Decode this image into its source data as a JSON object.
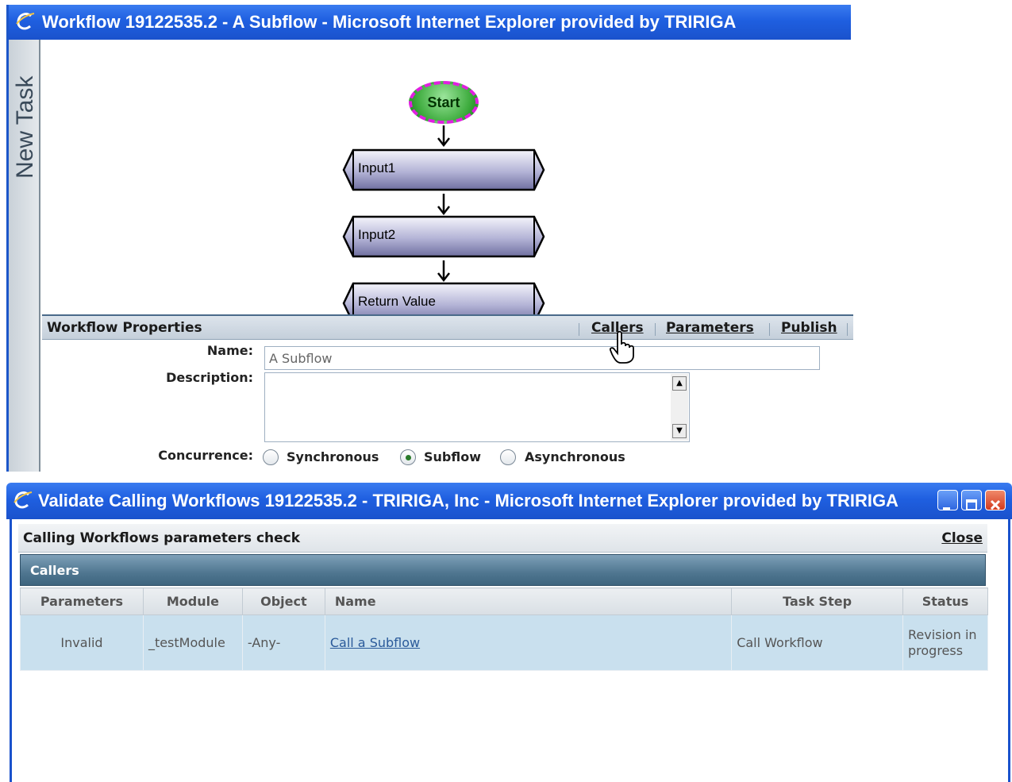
{
  "window1": {
    "title": "Workflow 19122535.2 - A Subflow - Microsoft Internet Explorer provided by TRIRIGA",
    "side_tab": "New Task",
    "diagram": {
      "start": "Start",
      "steps": [
        "Input1",
        "Input2",
        "Return Value"
      ]
    },
    "properties": {
      "title": "Workflow Properties",
      "links": {
        "callers": "Callers",
        "parameters": "Parameters",
        "publish": "Publish"
      },
      "name_label": "Name:",
      "name_value": "A Subflow",
      "description_label": "Description:",
      "description_value": "",
      "concurrence_label": "Concurrence:",
      "concurrence_options": [
        "Synchronous",
        "Subflow",
        "Asynchronous"
      ],
      "concurrence_selected": "Subflow"
    }
  },
  "window2": {
    "title": "Validate Calling Workflows 19122535.2 - TRIRIGA, Inc - Microsoft Internet Explorer provided by TRIRIGA",
    "header": {
      "title": "Calling Workflows parameters check",
      "close": "Close"
    },
    "section": "Callers",
    "columns": [
      "Parameters",
      "Module",
      "Object",
      "Name",
      "Task Step",
      "Status"
    ],
    "rows": [
      {
        "parameters": "Invalid",
        "module": "_testModule",
        "object": "-Any-",
        "name": "Call a Subflow",
        "task_step": "Call Workflow",
        "status": "Revision in progress"
      }
    ]
  },
  "colors": {
    "titlebar": "#1f5fe0",
    "invalid": "#d62020",
    "row_bg": "#c9e0ee",
    "callers_bar": "#4f7690",
    "start_border": "#e020e0",
    "start_fill": "#3aa93a"
  }
}
